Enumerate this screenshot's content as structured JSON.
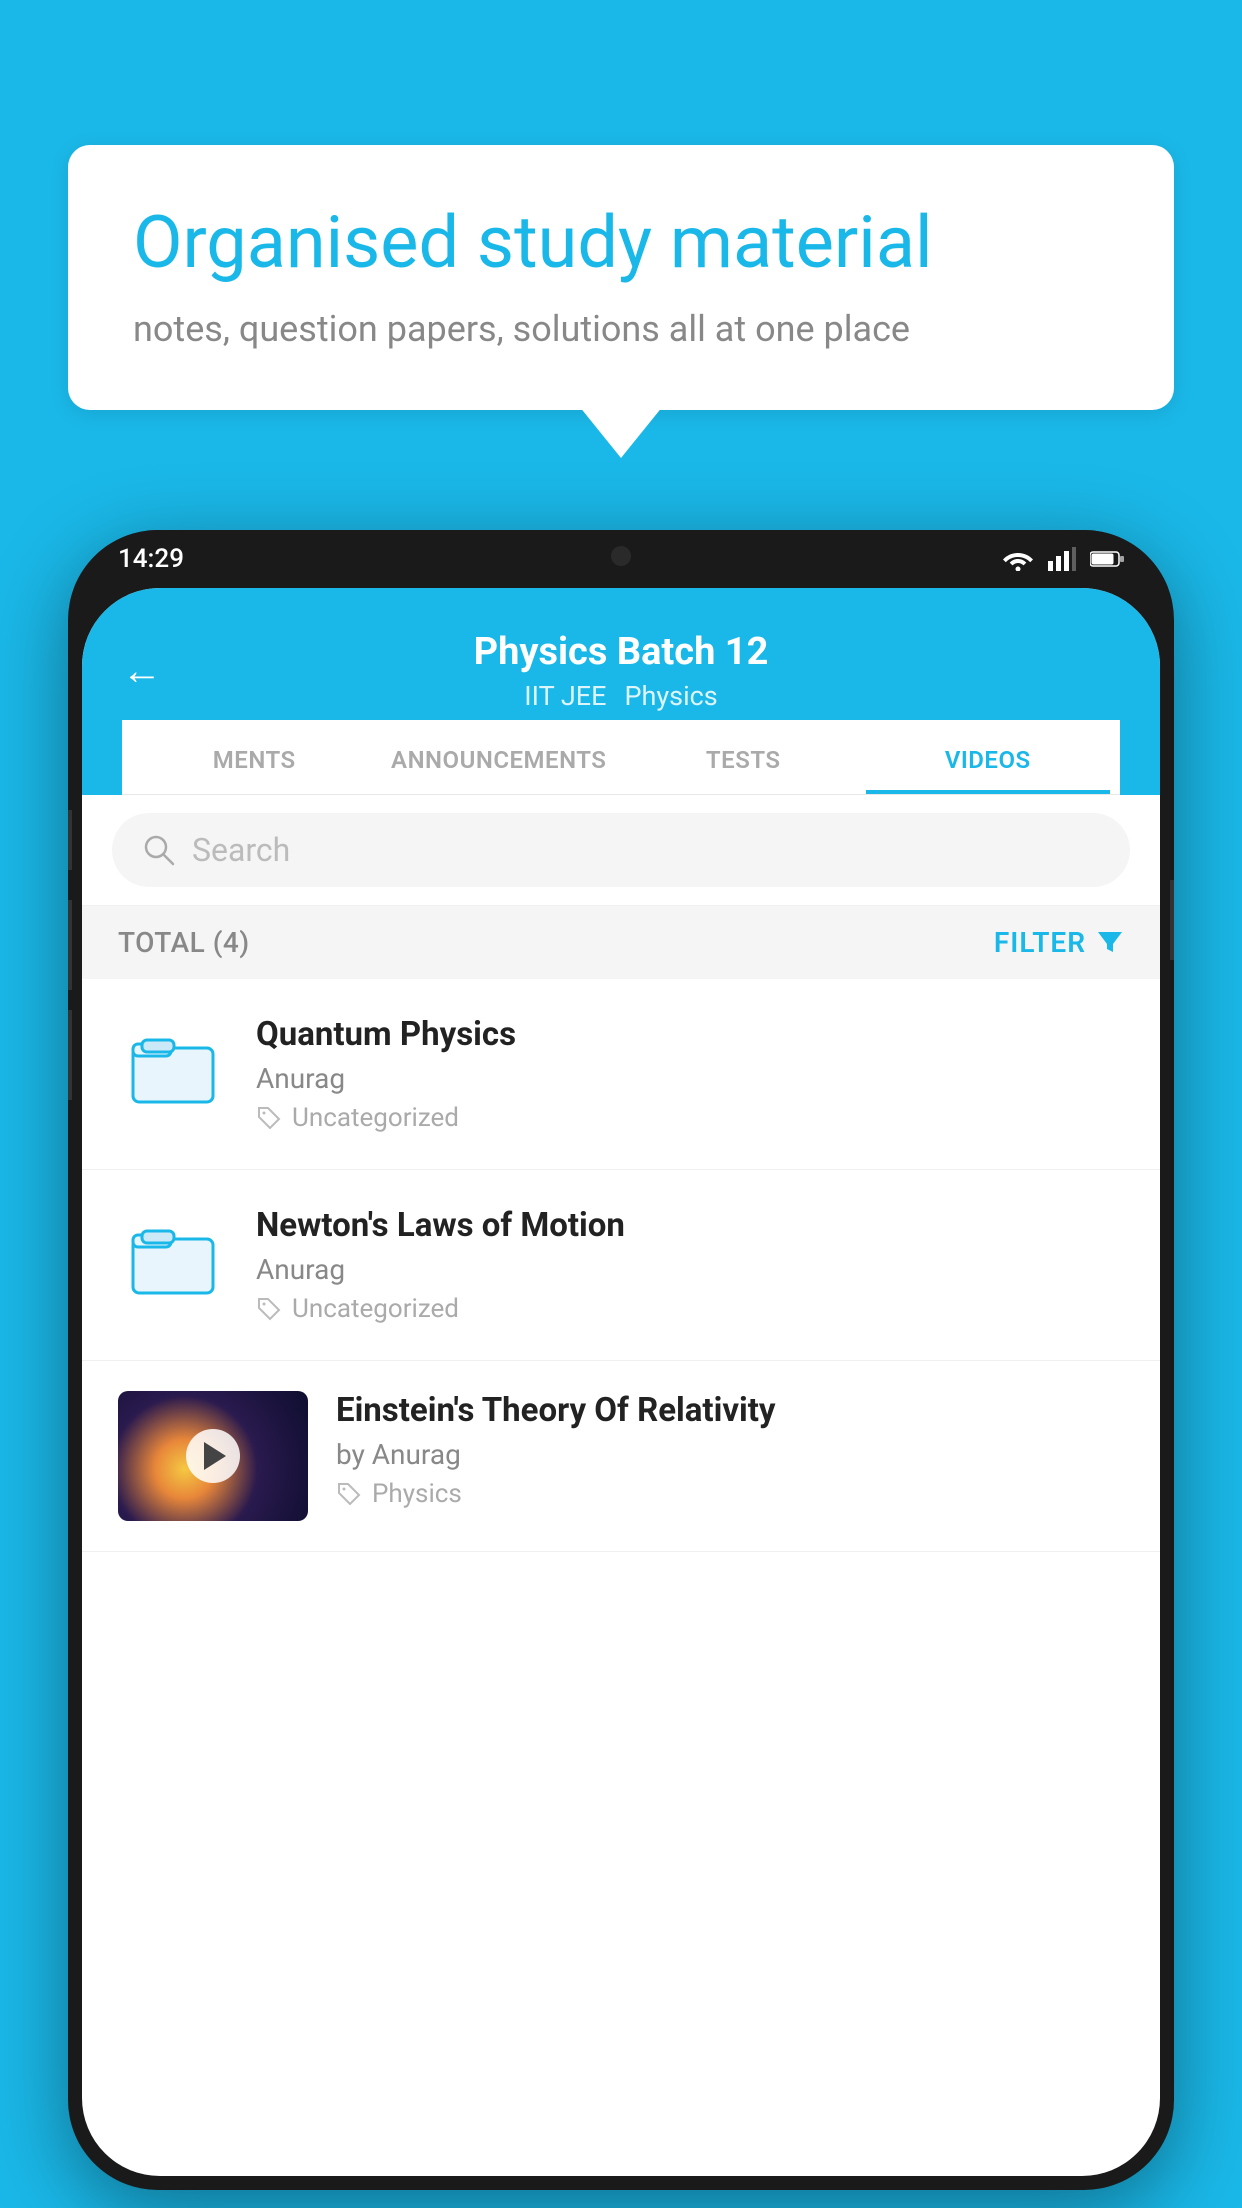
{
  "background_color": "#1ab8e8",
  "bubble": {
    "title": "Organised study material",
    "subtitle": "notes, question papers, solutions all at one place"
  },
  "phone": {
    "status_bar": {
      "time": "14:29"
    },
    "header": {
      "title": "Physics Batch 12",
      "tag1": "IIT JEE",
      "tag2": "Physics",
      "back_label": "←"
    },
    "tabs": [
      {
        "label": "MENTS",
        "active": false
      },
      {
        "label": "ANNOUNCEMENTS",
        "active": false
      },
      {
        "label": "TESTS",
        "active": false
      },
      {
        "label": "VIDEOS",
        "active": true
      }
    ],
    "search": {
      "placeholder": "Search"
    },
    "filter_bar": {
      "total_label": "TOTAL (4)",
      "filter_label": "FILTER"
    },
    "videos": [
      {
        "id": 1,
        "title": "Quantum Physics",
        "author": "Anurag",
        "tag": "Uncategorized",
        "type": "folder"
      },
      {
        "id": 2,
        "title": "Newton's Laws of Motion",
        "author": "Anurag",
        "tag": "Uncategorized",
        "type": "folder"
      },
      {
        "id": 3,
        "title": "Einstein's Theory Of Relativity",
        "author": "by Anurag",
        "tag": "Physics",
        "type": "video"
      }
    ]
  }
}
